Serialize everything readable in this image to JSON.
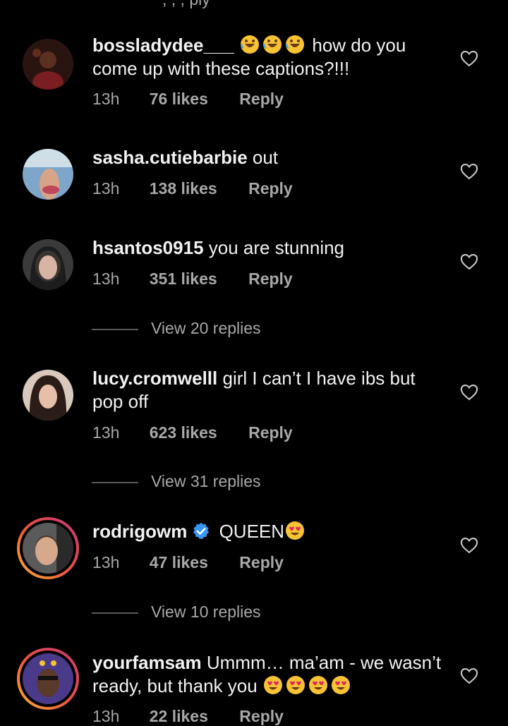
{
  "top_fragment": ", , , ply",
  "comments": [
    {
      "user": "bossladydee___",
      "text_before": "",
      "text": "how do you come up with these captions?!!!",
      "emoji_before": "rolling-on-floor-laughing x3",
      "time": "13h",
      "likes": "76 likes",
      "reply": "Reply"
    },
    {
      "user": "sasha.cutiebarbie",
      "text": "out",
      "time": "13h",
      "likes": "138 likes",
      "reply": "Reply"
    },
    {
      "user": "hsantos0915",
      "text": "you are stunning",
      "time": "13h",
      "likes": "351 likes",
      "reply": "Reply",
      "view_replies": "View 20 replies"
    },
    {
      "user": "lucy.cromwelll",
      "text": "girl I can’t I have ibs but pop off",
      "time": "13h",
      "likes": "623 likes",
      "reply": "Reply",
      "view_replies": "View 31 replies"
    },
    {
      "user": "rodrigowm",
      "text": "QUEEN",
      "emoji_after": "heart-eyes",
      "verified": true,
      "time": "13h",
      "likes": "47 likes",
      "reply": "Reply",
      "view_replies": "View 10 replies"
    },
    {
      "user": "yourfamsam",
      "text": "Ummm… ma’am - we wasn’t ready, but thank you",
      "emoji_after": "heart-eyes x4",
      "time": "13h",
      "likes": "22 likes",
      "reply": "Reply"
    }
  ],
  "icons": {
    "like": "heart-outline-icon",
    "verified": "verified-badge-icon"
  },
  "colors": {
    "background": "#000000",
    "text": "#f2f2f2",
    "meta": "#a8a8a8",
    "verified": "#3897f0"
  }
}
